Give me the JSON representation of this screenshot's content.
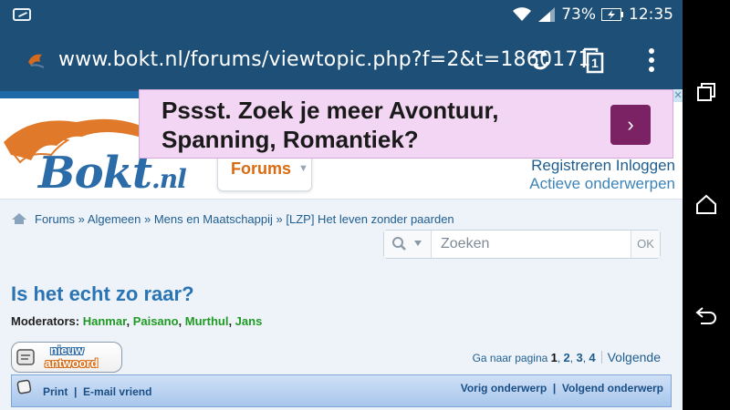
{
  "status": {
    "battery_percent": "73%",
    "time": "12:35"
  },
  "browser": {
    "url": "www.bokt.nl/forums/viewtopic.php?f=2&t=1860171",
    "tab_count": "1"
  },
  "header": {
    "logo_text": "Bokt",
    "logo_suffix": ".nl",
    "forums_tab": "Forums",
    "register_link": "Registreren",
    "login_link": "Inloggen",
    "active_topics_link": "Actieve onderwerpen"
  },
  "ad": {
    "line1": "Pssst. Zoek je meer Avontuur,",
    "line2": "Spanning, Romantiek?",
    "button": "›",
    "close": "✕"
  },
  "breadcrumb": {
    "items": [
      "Forums",
      "Algemeen",
      "Mens en Maatschappij",
      "[LZP] Het leven zonder paarden"
    ],
    "separator": " » "
  },
  "search": {
    "placeholder": "Zoeken",
    "ok_label": "OK"
  },
  "topic": {
    "title": "Is het echt zo raar?",
    "moderators_label": "Moderators:",
    "moderators": [
      "Hanmar",
      "Paisano",
      "Murthul",
      "Jans"
    ]
  },
  "reply_button": {
    "line1": "nieuw",
    "line2": "antwoord"
  },
  "pagination": {
    "label": "Ga naar pagina",
    "current": "1",
    "pages": [
      "2",
      "3",
      "4"
    ],
    "next": "Volgende"
  },
  "actions": {
    "print": "Print",
    "email": "E-mail vriend",
    "prev_topic": "Vorig onderwerp",
    "next_topic": "Volgend onderwerp"
  },
  "colors": {
    "browser_bar": "#1d4f77",
    "link": "#1f5d8f",
    "title": "#2a74b4",
    "moderator": "#1f9a22",
    "forums_tab": "#d96b10",
    "ad_bg": "#f2d6f4",
    "ad_button": "#7a2264"
  }
}
